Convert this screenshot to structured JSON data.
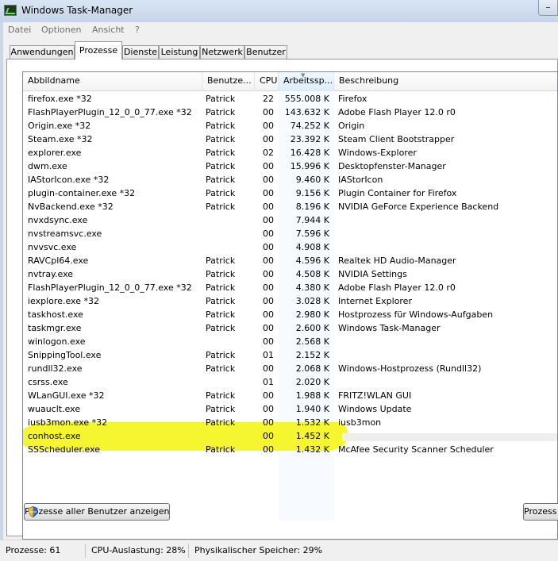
{
  "window": {
    "title": "Windows Task-Manager",
    "help_btn": "?"
  },
  "menu": [
    "Datei",
    "Optionen",
    "Ansicht",
    "?"
  ],
  "tabs": [
    "Anwendungen",
    "Prozesse",
    "Dienste",
    "Leistung",
    "Netzwerk",
    "Benutzer"
  ],
  "active_tab": "Prozesse",
  "columns": [
    "Abbildname",
    "Benutze...",
    "CPU",
    "Arbeitssp...",
    "Beschreibung"
  ],
  "processes": [
    {
      "name": "firefox.exe *32",
      "user": "Patrick",
      "cpu": "22",
      "mem": "555.008 K",
      "desc": "Firefox"
    },
    {
      "name": "FlashPlayerPlugin_12_0_0_77.exe *32",
      "user": "Patrick",
      "cpu": "00",
      "mem": "143.632 K",
      "desc": "Adobe Flash Player 12.0 r0"
    },
    {
      "name": "Origin.exe *32",
      "user": "Patrick",
      "cpu": "00",
      "mem": "74.252 K",
      "desc": "Origin"
    },
    {
      "name": "Steam.exe *32",
      "user": "Patrick",
      "cpu": "00",
      "mem": "23.392 K",
      "desc": "Steam Client Bootstrapper"
    },
    {
      "name": "explorer.exe",
      "user": "Patrick",
      "cpu": "02",
      "mem": "16.428 K",
      "desc": "Windows-Explorer"
    },
    {
      "name": "dwm.exe",
      "user": "Patrick",
      "cpu": "00",
      "mem": "15.996 K",
      "desc": "Desktopfenster-Manager"
    },
    {
      "name": "IAStorIcon.exe *32",
      "user": "Patrick",
      "cpu": "00",
      "mem": "9.460 K",
      "desc": "IAStorIcon"
    },
    {
      "name": "plugin-container.exe *32",
      "user": "Patrick",
      "cpu": "00",
      "mem": "9.156 K",
      "desc": "Plugin Container for Firefox"
    },
    {
      "name": "NvBackend.exe *32",
      "user": "Patrick",
      "cpu": "00",
      "mem": "8.196 K",
      "desc": "NVIDIA GeForce Experience Backend"
    },
    {
      "name": "nvxdsync.exe",
      "user": "",
      "cpu": "00",
      "mem": "7.944 K",
      "desc": ""
    },
    {
      "name": "nvstreamsvc.exe",
      "user": "",
      "cpu": "00",
      "mem": "7.596 K",
      "desc": ""
    },
    {
      "name": "nvvsvc.exe",
      "user": "",
      "cpu": "00",
      "mem": "4.908 K",
      "desc": ""
    },
    {
      "name": "RAVCpl64.exe",
      "user": "Patrick",
      "cpu": "00",
      "mem": "4.596 K",
      "desc": "Realtek HD Audio-Manager"
    },
    {
      "name": "nvtray.exe",
      "user": "Patrick",
      "cpu": "00",
      "mem": "4.508 K",
      "desc": "NVIDIA Settings"
    },
    {
      "name": "FlashPlayerPlugin_12_0_0_77.exe *32",
      "user": "Patrick",
      "cpu": "00",
      "mem": "4.380 K",
      "desc": "Adobe Flash Player 12.0 r0"
    },
    {
      "name": "iexplore.exe *32",
      "user": "Patrick",
      "cpu": "00",
      "mem": "3.028 K",
      "desc": "Internet Explorer"
    },
    {
      "name": "taskhost.exe",
      "user": "Patrick",
      "cpu": "00",
      "mem": "2.980 K",
      "desc": "Hostprozess für Windows-Aufgaben"
    },
    {
      "name": "taskmgr.exe",
      "user": "Patrick",
      "cpu": "00",
      "mem": "2.600 K",
      "desc": "Windows Task-Manager"
    },
    {
      "name": "winlogon.exe",
      "user": "",
      "cpu": "00",
      "mem": "2.568 K",
      "desc": ""
    },
    {
      "name": "SnippingTool.exe",
      "user": "Patrick",
      "cpu": "01",
      "mem": "2.152 K",
      "desc": ""
    },
    {
      "name": "rundll32.exe",
      "user": "Patrick",
      "cpu": "00",
      "mem": "2.068 K",
      "desc": "Windows-Hostprozess (Rundll32)"
    },
    {
      "name": "csrss.exe",
      "user": "",
      "cpu": "01",
      "mem": "2.020 K",
      "desc": ""
    },
    {
      "name": "WLanGUI.exe *32",
      "user": "Patrick",
      "cpu": "00",
      "mem": "1.988 K",
      "desc": "FRITZ!WLAN GUI"
    },
    {
      "name": "wuauclt.exe",
      "user": "Patrick",
      "cpu": "00",
      "mem": "1.940 K",
      "desc": "Windows Update"
    },
    {
      "name": "iusb3mon.exe *32",
      "user": "Patrick",
      "cpu": "00",
      "mem": "1.532 K",
      "desc": "iusb3mon"
    },
    {
      "name": "conhost.exe",
      "user": "",
      "cpu": "00",
      "mem": "1.452 K",
      "desc": ""
    },
    {
      "name": "SSScheduler.exe",
      "user": "Patrick",
      "cpu": "00",
      "mem": "1.432 K",
      "desc": "McAfee Security Scanner Scheduler"
    }
  ],
  "highlighted_process": "conhost.exe",
  "buttons": {
    "show_all": "Prozesse aller Benutzer anzeigen",
    "end_process": "Prozess beenden"
  },
  "status": {
    "processes": "Prozesse: 61",
    "cpu": "CPU-Auslastung: 28%",
    "memory": "Physikalischer Speicher: 29%"
  },
  "colors": {
    "highlight": "#f5f51e",
    "sorted_header": "#dcecfc",
    "titlebar": "#c4d4e8"
  }
}
